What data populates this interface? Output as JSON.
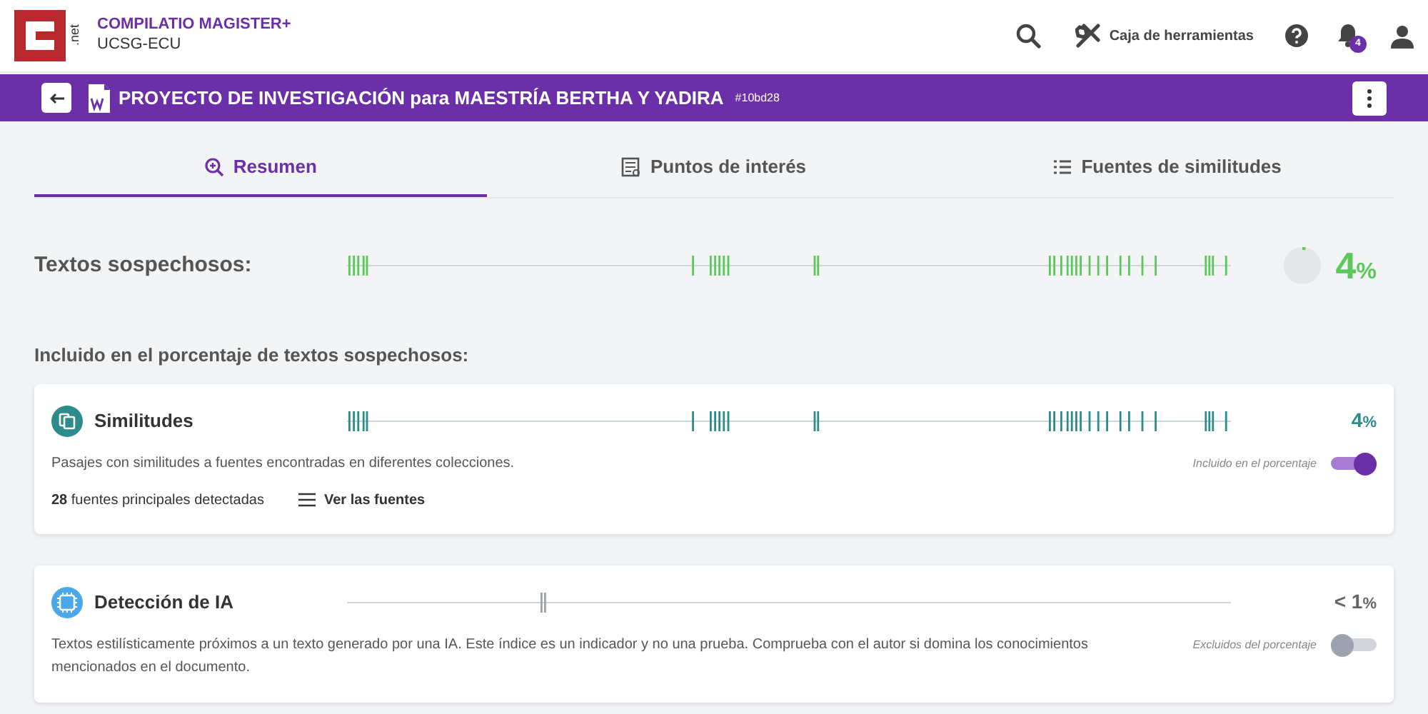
{
  "header": {
    "logo_suffix": ".net",
    "product": "COMPILATIO MAGISTER+",
    "organization": "UCSG-ECU",
    "toolbox": "Caja de herramientas",
    "notifications_count": "4"
  },
  "document": {
    "title": "PROYECTO DE INVESTIGACIÓN para MAESTRÍA BERTHA Y YADIRA",
    "id": "#10bd28"
  },
  "tabs": [
    {
      "label": "Resumen",
      "selected": true
    },
    {
      "label": "Puntos de interés",
      "selected": false
    },
    {
      "label": "Fuentes de similitudes",
      "selected": false
    }
  ],
  "suspicious": {
    "label": "Textos sospechosos:",
    "value": "4",
    "unit": "%"
  },
  "section_title": "Incluido en el porcentaje de textos sospechosos:",
  "cards": [
    {
      "kind": "similarity",
      "title": "Similitudes",
      "value": "4",
      "unit": "%",
      "description": "Pasajes con similitudes a fuentes encontradas en diferentes colecciones.",
      "toggle_label": "Incluido en el porcentaje",
      "on": true,
      "sources_count": "28",
      "sources_text": "fuentes principales detectadas",
      "sources_link": "Ver las fuentes"
    },
    {
      "kind": "ai",
      "title": "Detección de IA",
      "value": "< 1",
      "unit": "%",
      "description": "Textos estilísticamente próximos a un texto generado por una IA. Este índice es un indicador y no una prueba. Comprueba con el autor si domina los conocimientos mencionados en el documento.",
      "toggle_label": "Excluidos del porcentaje",
      "on": false
    }
  ]
}
